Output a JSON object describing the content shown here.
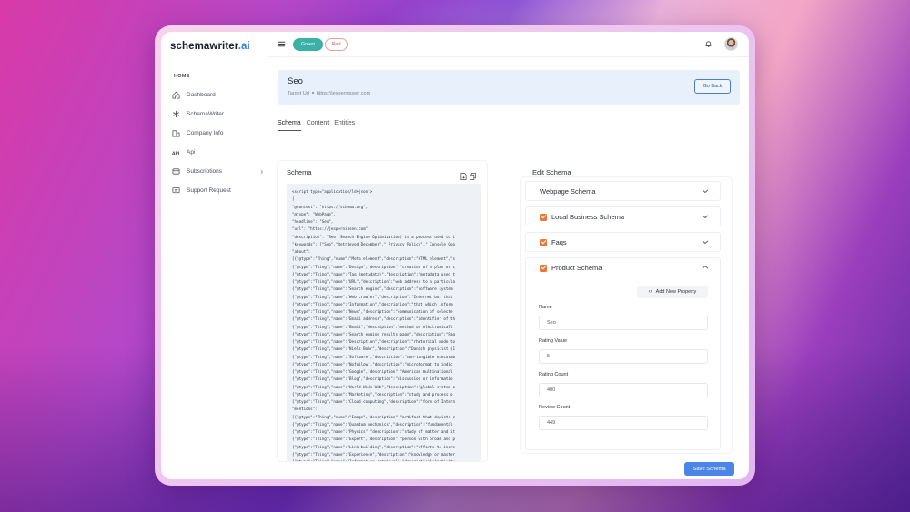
{
  "brand": {
    "name": "schemawriter",
    "suffix": ".ai"
  },
  "sidebar": {
    "section": "HOME",
    "items": [
      {
        "label": "Dashboard",
        "icon": "home-icon"
      },
      {
        "label": "SchemaWriter",
        "icon": "asterisk-icon"
      },
      {
        "label": "Company Info",
        "icon": "building-icon"
      },
      {
        "label": "Api",
        "icon": "api-icon"
      },
      {
        "label": "Subscriptions",
        "icon": "card-icon",
        "has_children": true
      },
      {
        "label": "Support Request",
        "icon": "chat-icon"
      }
    ]
  },
  "topbar": {
    "pill_green": "Green",
    "pill_red": "Red"
  },
  "banner": {
    "title": "Seo",
    "target_label": "Target Url",
    "target_url": "https://jespernissen.com",
    "go_back": "Go Back"
  },
  "tabs": [
    "Schema",
    "Content",
    "Entities"
  ],
  "schema": {
    "title": "Schema",
    "code_lines": [
      "<script type=\"application/ld+json\">",
      "{",
      "\"@context\": \"https://schema.org\",",
      "\"@type\": \"WebPage\",",
      "\"headline\": \"Seo\",",
      "\"url\": \"https://jespernissen.com\",",
      "\"description\": \"Seo (Search Engine Optimization) is a process used to i",
      "\"keywords\": [\"Seo\",\"Retrieved December\",\" Privacy Policy\",\" Console Goo",
      "\"about\":",
      "[{\"@type\":\"Thing\",\"name\":\"Meta element\",\"description\":\"HTML element\",\"s",
      "{\"@type\":\"Thing\",\"name\":\"Design\",\"description\":\"creation of a plan or c",
      "{\"@type\":\"Thing\",\"name\":\"Tag (metadata)\",\"description\":\"metadata used t",
      "{\"@type\":\"Thing\",\"name\":\"URL\",\"description\":\"web address to a particula",
      "{\"@type\":\"Thing\",\"name\":\"Search engine\",\"description\":\"software system",
      "{\"@type\":\"Thing\",\"name\":\"Web crawler\",\"description\":\"Internet bot that",
      "{\"@type\":\"Thing\",\"name\":\"Information\",\"description\":\"that which inform",
      "{\"@type\":\"Thing\",\"name\":\"News\",\"description\":\"communication of selecte",
      "{\"@type\":\"Thing\",\"name\":\"Email address\",\"description\":\"identifier of th",
      "{\"@type\":\"Thing\",\"name\":\"Email\",\"description\":\"method of electronicall",
      "{\"@type\":\"Thing\",\"name\":\"Search engine results page\",\"description\":\"Pag",
      "{\"@type\":\"Thing\",\"name\":\"Description\",\"description\":\"rhetorical mode to",
      "{\"@type\":\"Thing\",\"name\":\"Niels Bohr\",\"description\":\"Danish physicist (1",
      "{\"@type\":\"Thing\",\"name\":\"Software\",\"description\":\"non-tangible executab",
      "{\"@type\":\"Thing\",\"name\":\"Nofollow\",\"description\":\"microformat to indic",
      "{\"@type\":\"Thing\",\"name\":\"Google\",\"description\":\"American multinational",
      "{\"@type\":\"Thing\",\"name\":\"Blog\",\"description\":\"discussion or informatio",
      "{\"@type\":\"Thing\",\"name\":\"World Wide Web\",\"description\":\"global system o",
      "{\"@type\":\"Thing\",\"name\":\"Marketing\",\"description\":\"study and process o",
      "{\"@type\":\"Thing\",\"name\":\"Cloud computing\",\"description\":\"form of Intern",
      "\"mentions\":",
      "[{\"@type\":\"Thing\",\"name\":\"Image\",\"description\":\"artifact that depicts c",
      "{\"@type\":\"Thing\",\"name\":\"Quantum mechanics\",\"description\":\"fundamental",
      "{\"@type\":\"Thing\",\"name\":\"Physics\",\"description\":\"study of matter and it",
      "{\"@type\":\"Thing\",\"name\":\"Expert\",\"description\":\"person with broad and p",
      "{\"@type\":\"Thing\",\"name\":\"Link building\",\"description\":\"efforts to incre",
      "{\"@type\":\"Thing\",\"name\":\"Experience\",\"description\":\"knowledge or master",
      "{\"@type\":\"Thing\",\"name\":\"Information retrieval\",\"description\":\"activity",
      "{\"@type\":\"Thing\",\"name\":\"Newsletter\",\"description\":\"printed or electron",
      "{\"@type\":\"Thing\",\"name\":\"Backlink\",\"description\":\"Backlinks for a given",
      "{\"@type\":\"Thing\",\"name\":\"Engine\",\"description\":\"machine designed to pro"
    ]
  },
  "edit": {
    "title": "Edit Schema",
    "sections": [
      {
        "label": "Webpage Schema",
        "checked": false,
        "open": false
      },
      {
        "label": "Local Business Schema",
        "checked": true,
        "open": false
      },
      {
        "label": "Faqs",
        "checked": true,
        "open": false
      },
      {
        "label": "Product Schema",
        "checked": true,
        "open": true
      }
    ],
    "add_property": "Add New Property",
    "fields": [
      {
        "label": "Name",
        "value": "Seo"
      },
      {
        "label": "Rating Value",
        "value": "5"
      },
      {
        "label": "Rating Count",
        "value": "400"
      },
      {
        "label": "Review Count",
        "value": "449"
      }
    ]
  },
  "save_label": "Save Schema",
  "colors": {
    "accent": "#4b85e8",
    "green_pill": "#3bb0a6",
    "checkbox": "#e8793a",
    "banner_bg": "#e8f1fb"
  }
}
